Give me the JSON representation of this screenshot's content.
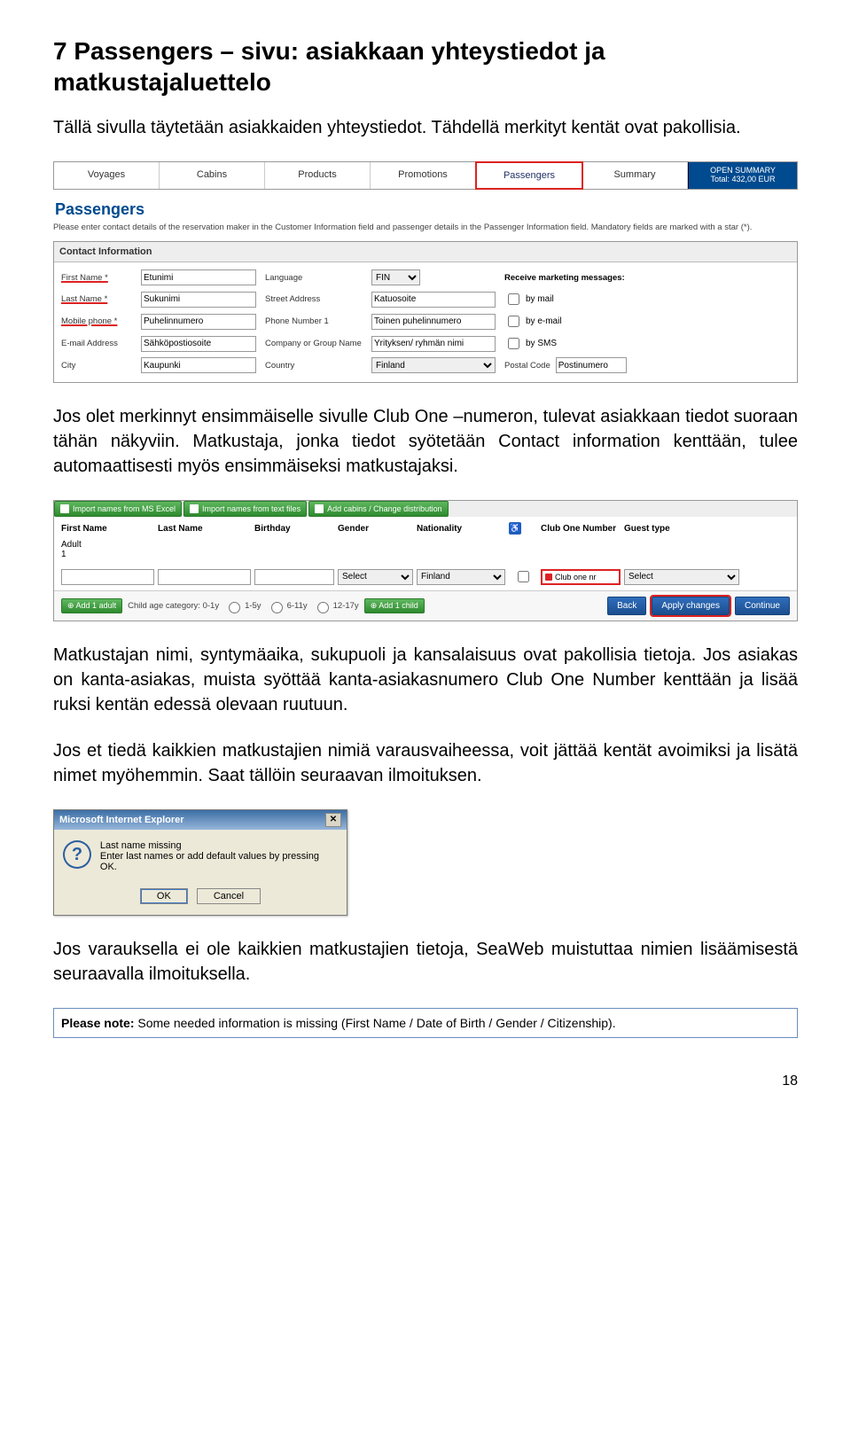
{
  "heading": "7  Passengers – sivu: asiakkaan yhteystiedot ja matkustajaluettelo",
  "intro": "Tällä sivulla täytetään asiakkaiden yhteystiedot. Tähdellä merkityt kentät ovat pakollisia.",
  "tabs": {
    "voyages": "Voyages",
    "cabins": "Cabins",
    "products": "Products",
    "promotions": "Promotions",
    "passengers": "Passengers",
    "summary": "Summary",
    "open_summary": "OPEN SUMMARY",
    "total": "Total: 432,00 EUR"
  },
  "passengers_header": "Passengers",
  "passengers_sub": "Please enter contact details of the reservation maker in the Customer Information field and passenger details in the Passenger Information field. Mandatory fields are marked with a star (*).",
  "ci": {
    "title": "Contact Information",
    "first_name_l": "First Name *",
    "last_name_l": "Last Name *",
    "mobile_l": "Mobile phone *",
    "email_l": "E-mail Address",
    "city_l": "City",
    "first_name_v": "Etunimi",
    "last_name_v": "Sukunimi",
    "mobile_v": "Puhelinnumero",
    "email_v": "Sähköpostiosoite",
    "city_v": "Kaupunki",
    "language_l": "Language",
    "street_l": "Street Address",
    "phone1_l": "Phone Number 1",
    "company_l": "Company or Group Name",
    "country_l": "Country",
    "language_v": "FIN",
    "street_v": "Katuosoite",
    "phone1_v": "Toinen puhelinnumero",
    "company_v": "Yrityksen/ ryhmän nimi",
    "country_v": "Finland",
    "mkt_title": "Receive marketing messages:",
    "by_mail": "by mail",
    "by_email": "by e-mail",
    "by_sms": "by SMS",
    "postal_l": "Postal Code",
    "postal_v": "Postinumero"
  },
  "mid_para": "Jos olet merkinnyt ensimmäiselle sivulle Club One –numeron, tulevat asiakkaan tiedot suoraan tähän näkyviin. Matkustaja, jonka tiedot syötetään Contact information kenttään, tulee automaattisesti myös ensimmäiseksi matkustajaksi.",
  "plist": {
    "import_excel": "Import names from MS Excel",
    "import_text": "Import names from text files",
    "add_cabins": "Add cabins / Change distribution",
    "hdr_first": "First Name",
    "hdr_last": "Last Name",
    "hdr_birth": "Birthday",
    "hdr_gender": "Gender",
    "hdr_nat": "Nationality",
    "hdr_co": "Club One Number",
    "hdr_guest": "Guest type",
    "adult_label": "Adult\n1",
    "gender_v": "Select",
    "nat_v": "Finland",
    "co_v": "Club one nr",
    "guest_v": "Select",
    "add_adult": "Add 1 adult",
    "child_cat": "Child age category: 0-1y",
    "r1": "1-5y",
    "r2": "6-11y",
    "r3": "12-17y",
    "add_child": "Add 1 child",
    "back": "Back",
    "apply": "Apply changes",
    "cont": "Continue"
  },
  "para_after_plist": "Matkustajan nimi, syntymäaika, sukupuoli ja kansalaisuus ovat pakollisia tietoja. Jos asiakas on kanta-asiakas, muista syöttää kanta-asiakasnumero Club One Number kenttään ja lisää ruksi kentän edessä olevaan ruutuun.",
  "para_after_plist2": "Jos et tiedä kaikkien matkustajien nimiä varausvaiheessa, voit jättää kentät avoimiksi ja lisätä nimet myöhemmin. Saat tällöin seuraavan ilmoituksen.",
  "ie": {
    "title": "Microsoft Internet Explorer",
    "l1": "Last name missing",
    "l2": "Enter last names or add default values by pressing OK.",
    "ok": "OK",
    "cancel": "Cancel"
  },
  "para_final": "Jos varauksella ei ole kaikkien matkustajien tietoja, SeaWeb muistuttaa nimien lisäämisestä seuraavalla ilmoituksella.",
  "note_bar": "Please note: Some needed information is missing (First Name / Date of Birth / Gender / Citizenship).",
  "page_num": "18"
}
